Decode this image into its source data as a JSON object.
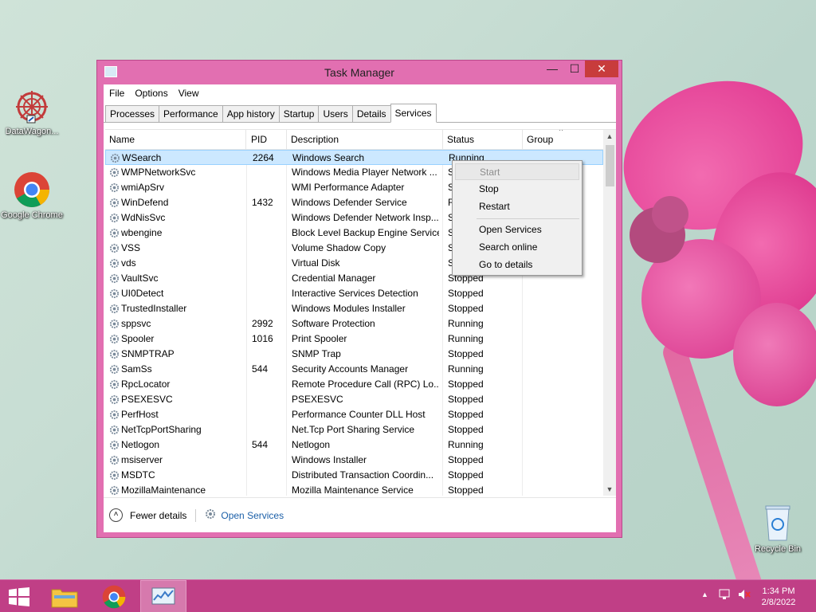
{
  "desktop": {
    "icons": [
      {
        "label": "DataWagon...",
        "icon": "datawagon-icon"
      },
      {
        "label": "Google Chrome",
        "icon": "chrome-icon"
      },
      {
        "label": "Recycle Bin",
        "icon": "recycle-bin-icon"
      }
    ]
  },
  "window": {
    "title": "Task Manager",
    "minimize": "—",
    "maximize": "☐",
    "close": "✕"
  },
  "menu": [
    "File",
    "Options",
    "View"
  ],
  "tabs": [
    "Processes",
    "Performance",
    "App history",
    "Startup",
    "Users",
    "Details",
    "Services"
  ],
  "active_tab": "Services",
  "columns": [
    "Name",
    "PID",
    "Description",
    "Status",
    "Group"
  ],
  "rows": [
    {
      "name": "WSearch",
      "pid": "2264",
      "desc": "Windows Search",
      "status": "Running"
    },
    {
      "name": "WMPNetworkSvc",
      "pid": "",
      "desc": "Windows Media Player Network ...",
      "status": "S"
    },
    {
      "name": "wmiApSrv",
      "pid": "",
      "desc": "WMI Performance Adapter",
      "status": "S"
    },
    {
      "name": "WinDefend",
      "pid": "1432",
      "desc": "Windows Defender Service",
      "status": "R"
    },
    {
      "name": "WdNisSvc",
      "pid": "",
      "desc": "Windows Defender Network Insp...",
      "status": "S"
    },
    {
      "name": "wbengine",
      "pid": "",
      "desc": "Block Level Backup Engine Service",
      "status": "S"
    },
    {
      "name": "VSS",
      "pid": "",
      "desc": "Volume Shadow Copy",
      "status": "S"
    },
    {
      "name": "vds",
      "pid": "",
      "desc": "Virtual Disk",
      "status": "S"
    },
    {
      "name": "VaultSvc",
      "pid": "",
      "desc": "Credential Manager",
      "status": "Stopped"
    },
    {
      "name": "UI0Detect",
      "pid": "",
      "desc": "Interactive Services Detection",
      "status": "Stopped"
    },
    {
      "name": "TrustedInstaller",
      "pid": "",
      "desc": "Windows Modules Installer",
      "status": "Stopped"
    },
    {
      "name": "sppsvc",
      "pid": "2992",
      "desc": "Software Protection",
      "status": "Running"
    },
    {
      "name": "Spooler",
      "pid": "1016",
      "desc": "Print Spooler",
      "status": "Running"
    },
    {
      "name": "SNMPTRAP",
      "pid": "",
      "desc": "SNMP Trap",
      "status": "Stopped"
    },
    {
      "name": "SamSs",
      "pid": "544",
      "desc": "Security Accounts Manager",
      "status": "Running"
    },
    {
      "name": "RpcLocator",
      "pid": "",
      "desc": "Remote Procedure Call (RPC) Lo...",
      "status": "Stopped"
    },
    {
      "name": "PSEXESVC",
      "pid": "",
      "desc": "PSEXESVC",
      "status": "Stopped"
    },
    {
      "name": "PerfHost",
      "pid": "",
      "desc": "Performance Counter DLL Host",
      "status": "Stopped"
    },
    {
      "name": "NetTcpPortSharing",
      "pid": "",
      "desc": "Net.Tcp Port Sharing Service",
      "status": "Stopped"
    },
    {
      "name": "Netlogon",
      "pid": "544",
      "desc": "Netlogon",
      "status": "Running"
    },
    {
      "name": "msiserver",
      "pid": "",
      "desc": "Windows Installer",
      "status": "Stopped"
    },
    {
      "name": "MSDTC",
      "pid": "",
      "desc": "Distributed Transaction Coordin...",
      "status": "Stopped"
    },
    {
      "name": "MozillaMaintenance",
      "pid": "",
      "desc": "Mozilla Maintenance Service",
      "status": "Stopped"
    }
  ],
  "selected_row": 0,
  "context_menu": [
    "Start",
    "Stop",
    "Restart",
    "Open Services",
    "Search online",
    "Go to details"
  ],
  "footer": {
    "fewer_details": "Fewer details",
    "open_services": "Open Services"
  },
  "taskbar": {
    "time": "1:34 PM",
    "date": "2/8/2022"
  },
  "colors": {
    "window_frame": "#e26fb1",
    "taskbar": "#c03f86",
    "selection": "#cce8ff",
    "close_button": "#c83c3c",
    "link": "#1b5fa8"
  }
}
